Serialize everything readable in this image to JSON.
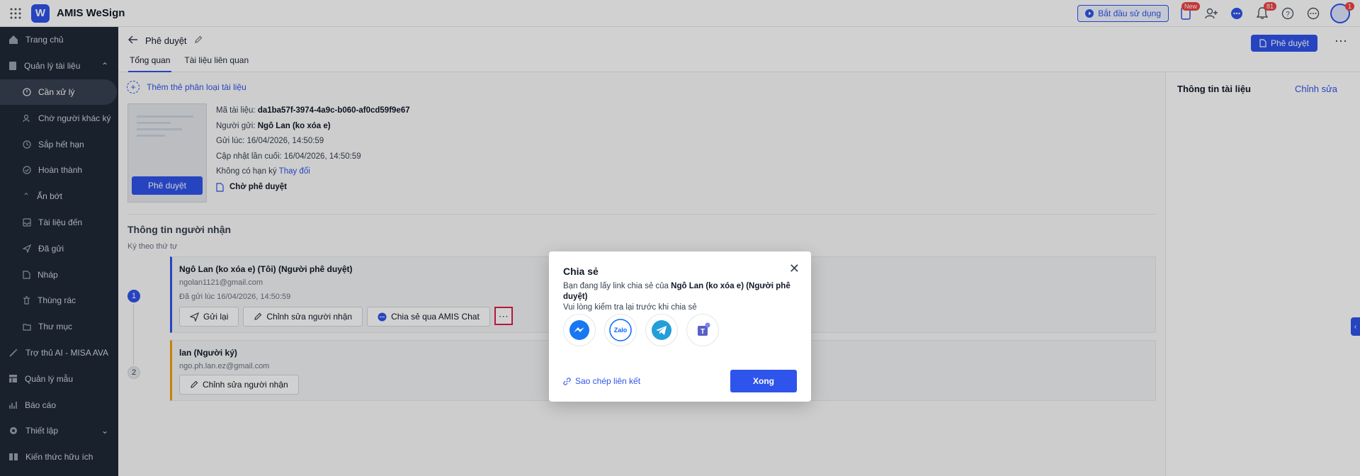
{
  "app": {
    "title": "AMIS WeSign",
    "logo_letter": "W"
  },
  "topbar": {
    "start_label": "Bắt đầu sử dụng",
    "new_badge": "New",
    "notif_badge": "81",
    "avatar_badge": "1"
  },
  "sidebar": {
    "items": [
      {
        "label": "Trang chủ",
        "icon": "home-icon"
      },
      {
        "label": "Quản lý tài liệu",
        "icon": "document-icon"
      },
      {
        "label": "Cần xử lý",
        "icon": "alert-circle-icon"
      },
      {
        "label": "Chờ người khác ký",
        "icon": "user-wait-icon"
      },
      {
        "label": "Sắp hết hạn",
        "icon": "clock-icon"
      },
      {
        "label": "Hoàn thành",
        "icon": "check-circle-icon"
      },
      {
        "label": "Ẩn bớt",
        "icon": "chevron-up-icon"
      },
      {
        "label": "Tài liệu đến",
        "icon": "inbox-icon"
      },
      {
        "label": "Đã gửi",
        "icon": "send-icon"
      },
      {
        "label": "Nháp",
        "icon": "draft-icon"
      },
      {
        "label": "Thùng rác",
        "icon": "trash-icon"
      },
      {
        "label": "Thư mục",
        "icon": "folder-icon"
      },
      {
        "label": "Trợ thủ AI - MISA AVA",
        "icon": "magic-wand-icon"
      },
      {
        "label": "Quản lý mẫu",
        "icon": "template-icon"
      },
      {
        "label": "Báo cáo",
        "icon": "chart-icon"
      },
      {
        "label": "Thiết lập",
        "icon": "gear-icon"
      },
      {
        "label": "Kiến thức hữu ích",
        "icon": "book-icon"
      }
    ]
  },
  "header": {
    "title": "Phê duyệt",
    "tabs": [
      "Tổng quan",
      "Tài liệu liên quan"
    ],
    "approve_button": "Phê duyệt"
  },
  "doc": {
    "add_category": "Thêm thẻ phân loại tài liệu",
    "thumb_button": "Phê duyệt",
    "code_label": "Mã tài liệu:",
    "code_value": "da1ba57f-3974-4a9c-b060-af0cd59f9e67",
    "sender_label": "Người gửi:",
    "sender_value": "Ngô Lan (ko xóa e)",
    "sent_at": "Gửi lúc: 16/04/2026, 14:50:59",
    "updated_at": "Cập nhật lần cuối: 16/04/2026, 14:50:59",
    "no_deadline": "Không có hạn ký",
    "change_link": "Thay đổi",
    "status": "Chờ phê duyệt"
  },
  "recipients": {
    "title": "Thông tin người nhận",
    "subtitle": "Ký theo thứ tự",
    "list": [
      {
        "step": "1",
        "name": "Ngô Lan (ko xóa e) (Tôi) (Người phê duyệt)",
        "email": "ngolan1121@gmail.com",
        "sent": "Đã gửi lúc 16/04/2026, 14:50:59",
        "actions": [
          "Gửi lại",
          "Chỉnh sửa người nhận",
          "Chia sẻ qua AMIS Chat"
        ]
      },
      {
        "step": "2",
        "name": "lan (Người ký)",
        "email": "ngo.ph.lan.ez@gmail.com",
        "actions": [
          "Chỉnh sửa người nhận"
        ]
      }
    ]
  },
  "right_panel": {
    "title": "Thông tin tài liệu",
    "edit": "Chỉnh sửa"
  },
  "modal": {
    "title": "Chia sẻ",
    "text_prefix": "Bạn đang lấy link chia sẻ của ",
    "text_name": "Ngô Lan (ko xóa e) (Người phê duyệt)",
    "text_line2": "Vui lòng kiểm tra lại trước khi chia sẻ",
    "share_targets": [
      "messenger-icon",
      "zalo-icon",
      "telegram-icon",
      "teams-icon"
    ],
    "zalo_text": "Zalo",
    "copy_link": "Sao chép liên kết",
    "done": "Xong"
  },
  "colors": {
    "primary": "#2f54eb",
    "sidebar": "#1f2937",
    "highlight": "#e11d48"
  }
}
